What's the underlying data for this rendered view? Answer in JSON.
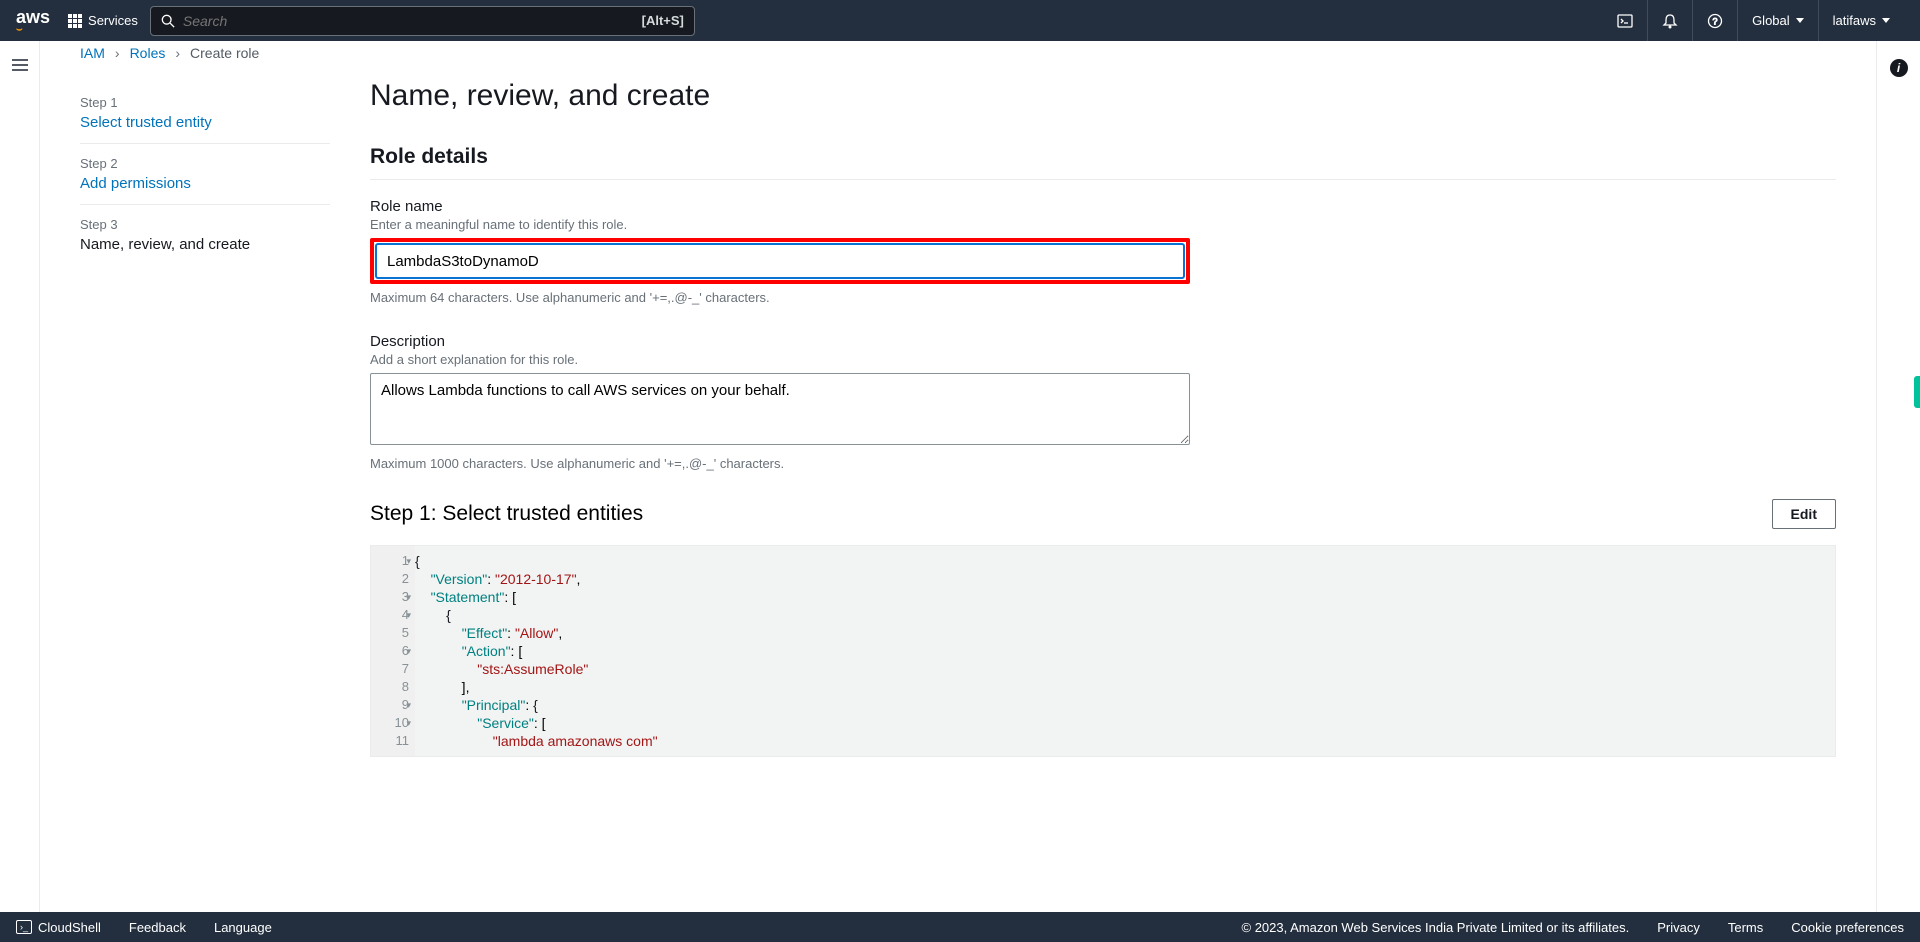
{
  "nav": {
    "services_label": "Services",
    "search_placeholder": "Search",
    "search_shortcut": "[Alt+S]",
    "region": "Global",
    "user": "latifaws"
  },
  "breadcrumb": {
    "iam": "IAM",
    "roles": "Roles",
    "current": "Create role"
  },
  "wizard": {
    "step1_num": "Step 1",
    "step1_title": "Select trusted entity",
    "step2_num": "Step 2",
    "step2_title": "Add permissions",
    "step3_num": "Step 3",
    "step3_title": "Name, review, and create"
  },
  "page": {
    "title": "Name, review, and create",
    "role_details_heading": "Role details",
    "role_name_label": "Role name",
    "role_name_hint": "Enter a meaningful name to identify this role.",
    "role_name_value": "LambdaS3toDynamoD",
    "role_name_constraint": "Maximum 64 characters. Use alphanumeric and '+=,.@-_' characters.",
    "description_label": "Description",
    "description_hint": "Add a short explanation for this role.",
    "description_value": "Allows Lambda functions to call AWS services on your behalf.",
    "description_constraint": "Maximum 1000 characters. Use alphanumeric and '+=,.@-_' characters.",
    "step1_heading": "Step 1: Select trusted entities",
    "edit_label": "Edit"
  },
  "policy": {
    "version_key": "\"Version\"",
    "version_val": "\"2012-10-17\"",
    "statement_key": "\"Statement\"",
    "effect_key": "\"Effect\"",
    "effect_val": "\"Allow\"",
    "action_key": "\"Action\"",
    "action_val": "\"sts:AssumeRole\"",
    "principal_key": "\"Principal\"",
    "service_key": "\"Service\"",
    "lambda_val": "\"lambda amazonaws com\""
  },
  "footer": {
    "cloudshell": "CloudShell",
    "feedback": "Feedback",
    "language": "Language",
    "copyright": "© 2023, Amazon Web Services India Private Limited or its affiliates.",
    "privacy": "Privacy",
    "terms": "Terms",
    "cookies": "Cookie preferences"
  }
}
